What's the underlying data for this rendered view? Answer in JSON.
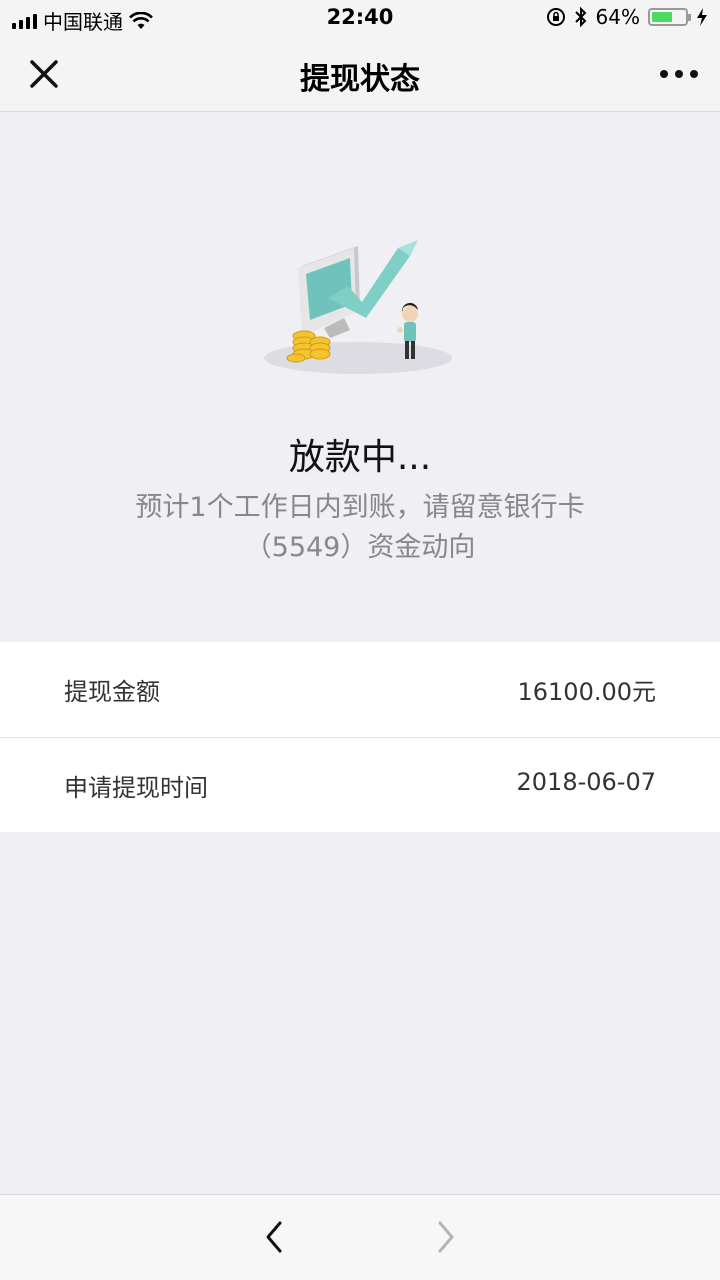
{
  "status_bar": {
    "carrier": "中国联通",
    "time": "22:40",
    "battery_percent": "64%",
    "battery_level": 0.64,
    "battery_color": "#4cd964"
  },
  "nav": {
    "title": "提现状态",
    "close_icon": "close-icon",
    "more_icon": "more-icon"
  },
  "status": {
    "title": "放款中...",
    "description": "预计1个工作日内到账，请留意银行卡（5549）资金动向"
  },
  "details": [
    {
      "label": "提现金额",
      "value": "16100.00元"
    },
    {
      "label": "申请提现时间",
      "value": "2018-06-07"
    }
  ],
  "toolbar": {
    "back_icon": "chevron-left-icon",
    "forward_icon": "chevron-right-icon"
  }
}
